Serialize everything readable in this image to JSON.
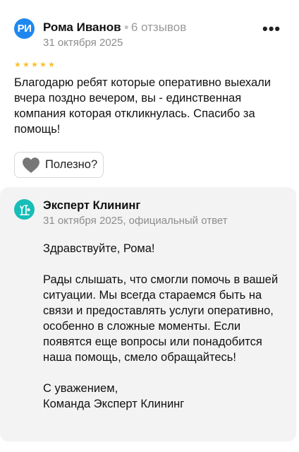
{
  "review": {
    "avatar_initials": "РИ",
    "author_name": "Рома Иванов",
    "reviews_count": "6 отзывов",
    "date": "31 октября 2025",
    "rating": 5,
    "text": "Благодарю ребят которые оперативно выехали вчера поздно вечером, вы - единственная компания которая откликнулась. Спасибо за помощь!",
    "helpful_label": "Полезно?",
    "more_icon": "more-dots-icon"
  },
  "reply": {
    "company_name": "Эксперт Клининг",
    "meta": "31 октября 2025, официальный ответ",
    "greeting": "Здравствуйте, Рома!",
    "body": "Рады слышать, что смогли помочь в вашей ситуации. Мы всегда стараемся быть на связи и предоставлять услуги оперативно, особенно в сложные моменты. Если появятся еще вопросы или понадобится наша помощь, смело обращайтесь!",
    "signoff_line1": "С уважением,",
    "signoff_line2": "Команда Эксперт Клининг"
  },
  "colors": {
    "avatar": "#1e88f0",
    "star": "#fbc02d",
    "reply_bg": "#f3f3f3",
    "company_logo": "#17bdb8"
  }
}
